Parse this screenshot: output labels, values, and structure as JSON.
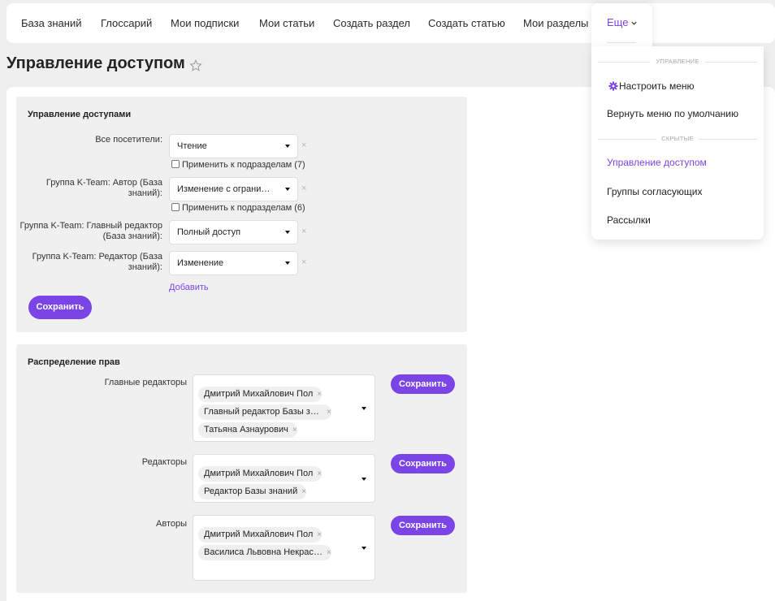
{
  "nav": {
    "items": [
      "База знаний",
      "Глоссарий",
      "Мои подписки",
      "Мои статьи",
      "Создать раздел",
      "Создать статью",
      "Мои разделы"
    ],
    "more_label": "Еще"
  },
  "page": {
    "title": "Управление доступом"
  },
  "access_panel": {
    "title": "Управление доступами",
    "rows": [
      {
        "label": "Все посетители:",
        "value": "Чтение",
        "apply_label": "Применить к подразделам (7)"
      },
      {
        "label": "Группа K-Team: Автор (База знаний):",
        "value": "Изменение с ограничением",
        "apply_label": "Применить к подразделам (6)"
      },
      {
        "label": "Группа K-Team: Главный редактор (База знаний):",
        "value": "Полный доступ"
      },
      {
        "label": "Группа K-Team: Редактор (База знаний):",
        "value": "Изменение"
      }
    ],
    "remove_glyph": "×",
    "add_label": "Добавить",
    "save_label": "Сохранить"
  },
  "rights_panel": {
    "title": "Распределение прав",
    "groups": [
      {
        "label": "Главные редакторы",
        "tags": [
          "Дмитрий Михайлович Пол",
          "Главный редактор Базы знаний",
          "Татьяна Азнаурович"
        ],
        "save_label": "Сохранить"
      },
      {
        "label": "Редакторы",
        "tags": [
          "Дмитрий Михайлович Пол",
          "Редактор Базы знаний"
        ],
        "save_label": "Сохранить"
      },
      {
        "label": "Авторы",
        "tags": [
          "Дмитрий Михайлович Пол",
          "Василиса Львовна Некрасова"
        ],
        "save_label": "Сохранить"
      }
    ],
    "tag_remove_glyph": "×"
  },
  "dropdown": {
    "section_manage": "УПРАВЛЕНИЕ",
    "configure_menu": "Настроить меню",
    "reset_menu": "Вернуть меню по умолчанию",
    "section_hidden": "СКРЫТЫЕ",
    "hidden_items": [
      "Управление доступом",
      "Группы согласующих",
      "Рассылки"
    ]
  },
  "colors": {
    "accent": "#7b44e6",
    "panel": "#f0f0f0",
    "background": "#efefef"
  }
}
